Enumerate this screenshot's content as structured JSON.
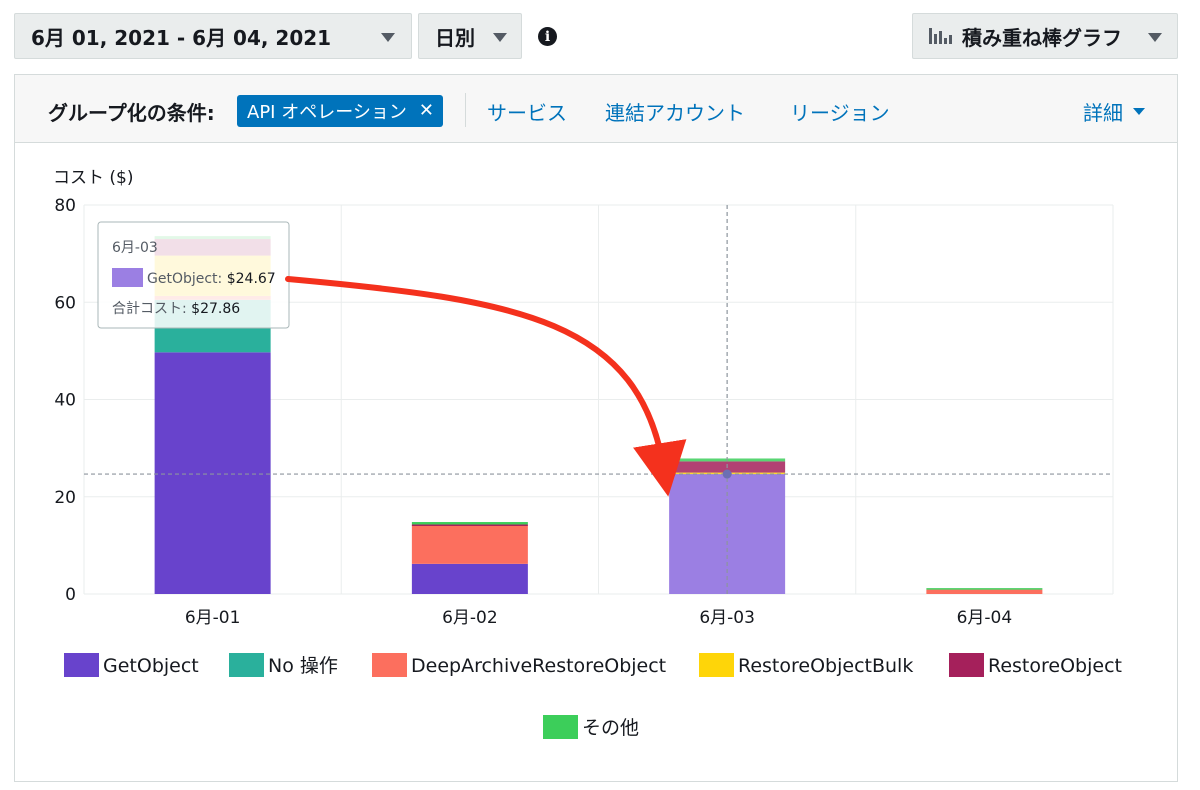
{
  "toolbar": {
    "date_range": "6月 01, 2021 - 6月 04, 2021",
    "granularity": "日別",
    "info_icon": "i",
    "chart_type": "積み重ね棒グラフ"
  },
  "filter": {
    "group_label": "グループ化の条件:",
    "chip_label": "API オペレーション",
    "links": [
      "サービス",
      "連結アカウント",
      "リージョン"
    ],
    "more": "詳細"
  },
  "chart_data": {
    "type": "bar",
    "stacked": true,
    "ylabel": "コスト ($)",
    "ylim": [
      0,
      80
    ],
    "yticks": [
      0,
      20,
      40,
      60,
      80
    ],
    "categories": [
      "6月-01",
      "6月-02",
      "6月-03",
      "6月-04"
    ],
    "series": [
      {
        "name": "GetObject",
        "color": "#6843cc",
        "values": [
          49.7,
          6.2,
          24.67,
          0
        ]
      },
      {
        "name": "No 操作",
        "color": "#2ab09c",
        "values": [
          10.8,
          0,
          0,
          0
        ]
      },
      {
        "name": "DeepArchiveRestoreObject",
        "color": "#fc6f5e",
        "values": [
          0.8,
          7.9,
          0,
          0.9
        ]
      },
      {
        "name": "RestoreObjectBulk",
        "color": "#fed509",
        "values": [
          8.3,
          0,
          0.3,
          0
        ]
      },
      {
        "name": "RestoreObject",
        "color": "#a5205b",
        "values": [
          3.4,
          0.2,
          2.3,
          0
        ]
      },
      {
        "name": "その他",
        "color": "#3cce5a",
        "values": [
          0.6,
          0.5,
          0.6,
          0.3
        ]
      }
    ],
    "highlight": {
      "category_index": 2,
      "series_index": 0,
      "value": 24.67
    },
    "tooltip": {
      "title": "6月-03",
      "series_label": "GetObject: ",
      "series_value": "$24.67",
      "total_label": "合計コスト: ",
      "total_value": "$27.86"
    },
    "annotation": "red-arrow"
  }
}
